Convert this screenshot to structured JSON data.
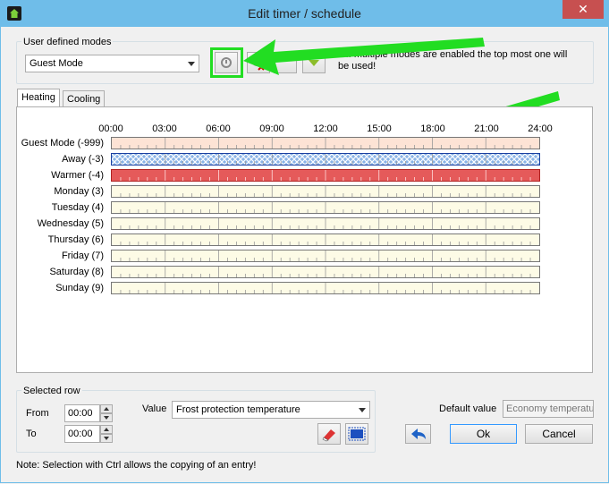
{
  "window": {
    "title": "Edit timer / schedule",
    "close_glyph": "✕"
  },
  "modes": {
    "group_label": "User defined modes",
    "selected": "Guest Mode",
    "note": "If multiple modes are enabled the top most one will be used!",
    "note_visible_line1": "al. If multiple modes are enabled the top most one will",
    "note_visible_line2": "be used!"
  },
  "tabs": [
    {
      "label": "Heating"
    },
    {
      "label": "Cooling"
    }
  ],
  "schedule": {
    "hours": [
      "00:00",
      "03:00",
      "06:00",
      "09:00",
      "12:00",
      "15:00",
      "18:00",
      "21:00",
      "24:00"
    ],
    "rows": [
      {
        "label": "Guest Mode (-999)",
        "fill": "#fde3d5",
        "pattern": "none"
      },
      {
        "label": "Away (-3)",
        "fill": "#8ab4e6",
        "pattern": "crosshatch"
      },
      {
        "label": "Warmer (-4)",
        "fill": "#e55a5a",
        "pattern": "none"
      },
      {
        "label": "Monday (3)",
        "fill": "#fdfbe6",
        "pattern": "none"
      },
      {
        "label": "Tuesday (4)",
        "fill": "#fdfbe6",
        "pattern": "none"
      },
      {
        "label": "Wednesday (5)",
        "fill": "#fdfbe6",
        "pattern": "none"
      },
      {
        "label": "Thursday (6)",
        "fill": "#fdfbe6",
        "pattern": "none"
      },
      {
        "label": "Friday (7)",
        "fill": "#fdfbe6",
        "pattern": "none"
      },
      {
        "label": "Saturday (8)",
        "fill": "#fdfbe6",
        "pattern": "none"
      },
      {
        "label": "Sunday (9)",
        "fill": "#fdfbe6",
        "pattern": "none"
      }
    ]
  },
  "selected_row": {
    "group_label": "Selected row",
    "from_label": "From",
    "from_value": "00:00",
    "to_label": "To",
    "to_value": "00:00",
    "value_label": "Value",
    "value_selected": "Frost protection temperature"
  },
  "default_value": {
    "label": "Default value",
    "value": "Economy temperatu"
  },
  "buttons": {
    "ok": "Ok",
    "cancel": "Cancel"
  },
  "footer_note": "Note: Selection with Ctrl allows the copying of an entry!",
  "colors": {
    "annotation_arrow": "#22dd22",
    "titlebar": "#6fbde9",
    "close": "#c75050"
  }
}
